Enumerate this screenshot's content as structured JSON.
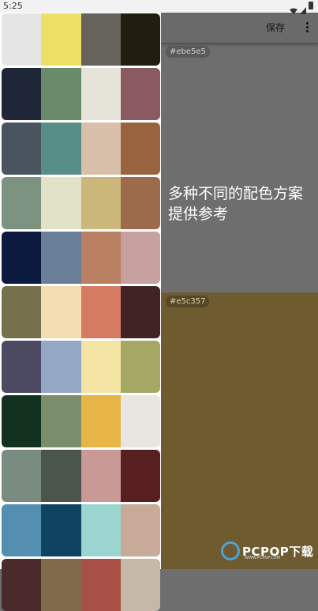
{
  "status": {
    "time": "5:25"
  },
  "toolbar": {
    "save_label": "保存"
  },
  "preview": {
    "top_hex": "#ebe5e5",
    "bottom_hex": "#e5c357",
    "description": "多种不同的配色方案提供参考"
  },
  "watermark": {
    "text": "PCPOP下载",
    "sub": "WWW.PCPOP.COM"
  },
  "palettes": [
    [
      "#e5e5e5",
      "#ebe065",
      "#66625c",
      "#221e0f"
    ],
    [
      "#1e2638",
      "#698b69",
      "#e6e4d8",
      "#8a5a60"
    ],
    [
      "#4a545e",
      "#578f88",
      "#d8bfaa",
      "#9a6340"
    ],
    [
      "#7b9380",
      "#e2e2c6",
      "#cab779",
      "#9b6b4b"
    ],
    [
      "#0b1a3e",
      "#6a7f99",
      "#b87f61",
      "#c7a0a0"
    ],
    [
      "#77704d",
      "#f4deb1",
      "#d57b62",
      "#412325"
    ],
    [
      "#4b4a62",
      "#94a7c4",
      "#f4e5a4",
      "#a5a865"
    ],
    [
      "#12311f",
      "#7a8e6c",
      "#e7b546",
      "#e9e5e1"
    ],
    [
      "#7a8c80",
      "#4a554b",
      "#c99996",
      "#581f20"
    ],
    [
      "#548fb2",
      "#0e4461",
      "#9ad5cf",
      "#c7aa98"
    ],
    [
      "#4a2a2a",
      "#7f6a4a",
      "#a85045",
      "#c5b8a8"
    ]
  ]
}
